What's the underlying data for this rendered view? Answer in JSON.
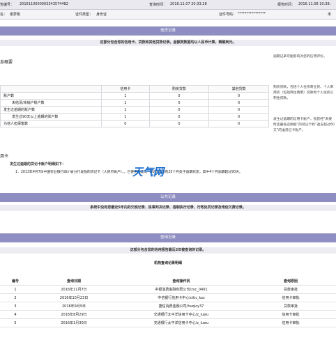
{
  "header": {
    "report_no_label": "告编号：",
    "report_no": "2016110000003343574482",
    "query_time_label": "查询时间：",
    "query_time": "2016.11.07 20:33:28",
    "report_time_label": "报告时间：",
    "report_time": "2016.11.08 10:38:",
    "name_label": "名：",
    "name": "谢梦桃",
    "id_type_label": "证件类型：",
    "id_type": "身份证",
    "id_no_label": "证件号码：",
    "id_no": "****************",
    "extra": "未"
  },
  "credit_section": {
    "title": "信贷记录",
    "banner": "这部分包含您的信用卡、贷款和其他贷款记录。金额类数据均以人民币计算，精确到元。",
    "summary_title": "息概要",
    "right_note": "逾期记录可能影响对您的信用评价。",
    "table": {
      "headers": [
        "",
        "信用卡",
        "购房贷款",
        "其他贷款"
      ],
      "rows": [
        [
          "账户数",
          "1",
          "0",
          "0"
        ],
        [
          "未结清/未销户账户数",
          "1",
          "0",
          "0"
        ],
        [
          "发生过逾期的账户数",
          "1",
          "0",
          "0"
        ],
        [
          "发生过90天以上逾期的账户数",
          "1",
          "0",
          "0"
        ],
        [
          "为他人担保笔数",
          "0",
          "0",
          "0"
        ]
      ]
    },
    "side_notes": [
      "购房贷款，包括个人住房商业贷、个人商用房（包括商住两用）贷款和个人住房公积金贷款。",
      "发生过逾期的信用卡账户，指曾经“未按时还最低还款额”的贷记卡和“透支超过60天”的准贷记卡账户。"
    ],
    "detail_title": "用卡",
    "detail_subtitle": "发生过逾期的贷记卡账户明细如下：",
    "detail_item": "1．2013年4月7日中国农业银行四川省分行发放的贷记卡（人民币账户）。",
    "detail_item_tail": "，已使用额度0。最近5年内有25个月处于逾期状态，其中4个月逾期超过90天。",
    "watermark": "天气网"
  },
  "public_section": {
    "title": "公共记录",
    "banner": "系统中没有您最近5年内的欠税记录、民事判决记录、强制执行记录、行政处罚记录及电信欠费记录。"
  },
  "query_section": {
    "title": "查询记录",
    "banner": "这部分包含您的信用报告最近2年被查询的记录。",
    "subtitle": "机构查询记录明细",
    "headers": [
      "编号",
      "查询日期",
      "查询操作员",
      "查询原因"
    ],
    "rows": [
      [
        "1",
        "2016年11月7日",
        "中银消费金融有限公司/zxc_0401",
        "贷款审批"
      ],
      [
        "2",
        "2016年10月23日",
        "中信银行信用卡中心/citic_kzz",
        "信用卡审批"
      ],
      [
        "3",
        "2016年9月9日",
        "捷信消费金融公司/huqicy37",
        "贷款审批"
      ],
      [
        "4",
        "2016年8月29日",
        "交通银行太平洋信用卡中心/z_luwu",
        "信用卡审批"
      ],
      [
        "5",
        "2016年1月30日",
        "交通银行太平洋信用卡中心/z_luwu",
        "信用卡审批"
      ]
    ]
  }
}
